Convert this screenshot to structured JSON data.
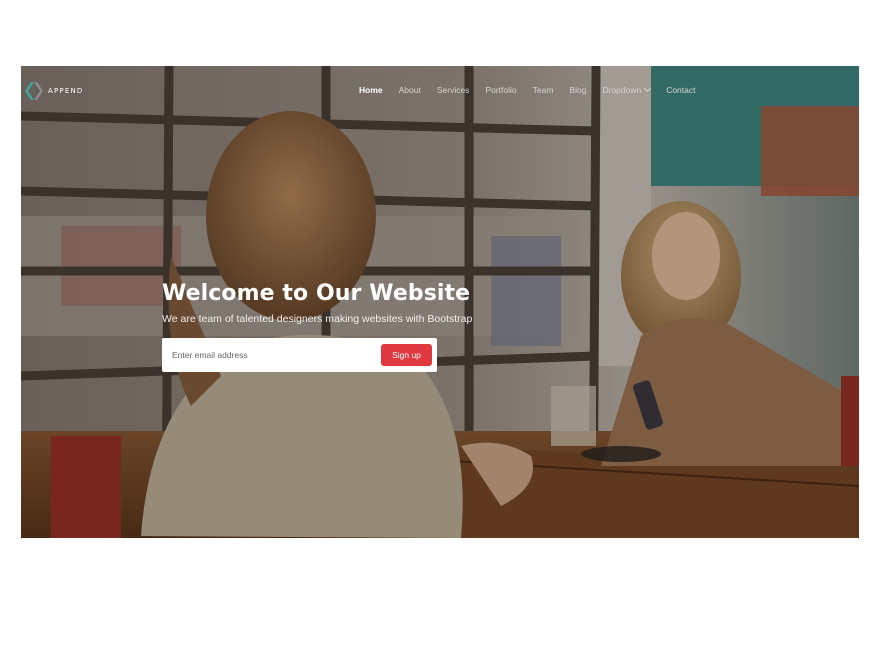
{
  "brand": {
    "name": "APPEND",
    "logo_icon": "chevron-logo-icon"
  },
  "nav": {
    "items": [
      {
        "label": "Home",
        "active": true
      },
      {
        "label": "About"
      },
      {
        "label": "Services"
      },
      {
        "label": "Portfolio"
      },
      {
        "label": "Team"
      },
      {
        "label": "Blog"
      },
      {
        "label": "Dropdown",
        "icon": "chevron-down-icon"
      },
      {
        "label": "Contact"
      }
    ]
  },
  "hero": {
    "title": "Welcome to Our Website",
    "subtitle": "We are team of talented designers making websites with Bootstrap",
    "email_placeholder": "Enter email address",
    "signup_label": "Sign up",
    "image_description": "cafe-two-women-photo"
  },
  "colors": {
    "accent": "#e0393f",
    "logo_teal": "#3fa7a0",
    "logo_gray": "#8a8a8a"
  }
}
